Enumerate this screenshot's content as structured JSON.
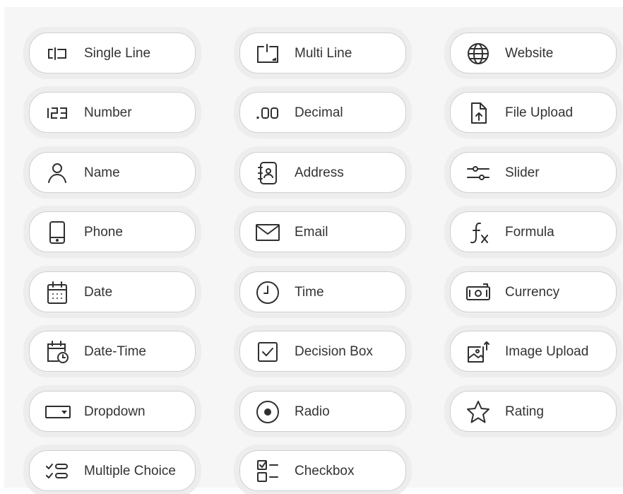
{
  "fields": [
    {
      "label": "Single Line",
      "icon": "single-line-icon"
    },
    {
      "label": "Multi Line",
      "icon": "multi-line-icon"
    },
    {
      "label": "Website",
      "icon": "globe-icon"
    },
    {
      "label": "Number",
      "icon": "number-icon",
      "glyph": "123"
    },
    {
      "label": "Decimal",
      "icon": "decimal-icon",
      "glyph": ".00"
    },
    {
      "label": "File Upload",
      "icon": "file-upload-icon"
    },
    {
      "label": "Name",
      "icon": "person-icon"
    },
    {
      "label": "Address",
      "icon": "address-book-icon"
    },
    {
      "label": "Slider",
      "icon": "slider-icon"
    },
    {
      "label": "Phone",
      "icon": "phone-icon"
    },
    {
      "label": "Email",
      "icon": "envelope-icon"
    },
    {
      "label": "Formula",
      "icon": "formula-icon"
    },
    {
      "label": "Date",
      "icon": "calendar-icon"
    },
    {
      "label": "Time",
      "icon": "clock-icon"
    },
    {
      "label": "Currency",
      "icon": "currency-icon"
    },
    {
      "label": "Date-Time",
      "icon": "calendar-clock-icon"
    },
    {
      "label": "Decision Box",
      "icon": "checked-box-icon"
    },
    {
      "label": "Image Upload",
      "icon": "image-upload-icon"
    },
    {
      "label": "Dropdown",
      "icon": "dropdown-icon"
    },
    {
      "label": "Radio",
      "icon": "radio-icon"
    },
    {
      "label": "Rating",
      "icon": "star-icon"
    },
    {
      "label": "Multiple Choice",
      "icon": "multiple-choice-icon"
    },
    {
      "label": "Checkbox",
      "icon": "checkbox-list-icon"
    }
  ]
}
